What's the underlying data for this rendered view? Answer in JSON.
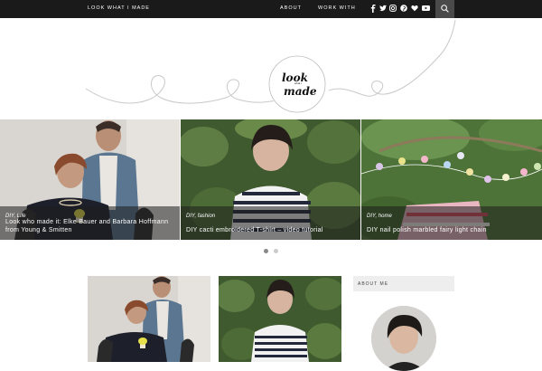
{
  "topbar": {
    "brand": "LOOK WHAT I MADE",
    "nav": [
      {
        "label": "ABOUT"
      },
      {
        "label": "WORK WITH"
      }
    ],
    "social_icons": [
      "facebook-icon",
      "twitter-icon",
      "instagram-icon",
      "pinterest-icon",
      "heart-icon",
      "youtube-icon"
    ]
  },
  "logo": {
    "line1": "look",
    "line2": "made",
    "small": "what i"
  },
  "slider": {
    "slides": [
      {
        "category": "DIY, Life",
        "title": "Look who made it: Elke Bauer and Barbara Hoffmann from Young & Smitten"
      },
      {
        "category": "DIY, fashion",
        "title": "DIY cacti embroidered T-shirt – video tutorial"
      },
      {
        "category": "DIY, home",
        "title": "DIY nail polish marbled fairy light chain"
      }
    ],
    "active_dot": 0
  },
  "sidebar": {
    "about_heading": "ABOUT ME"
  },
  "colors": {
    "bar": "#1a1a1a",
    "accent_dot": "#888888"
  }
}
